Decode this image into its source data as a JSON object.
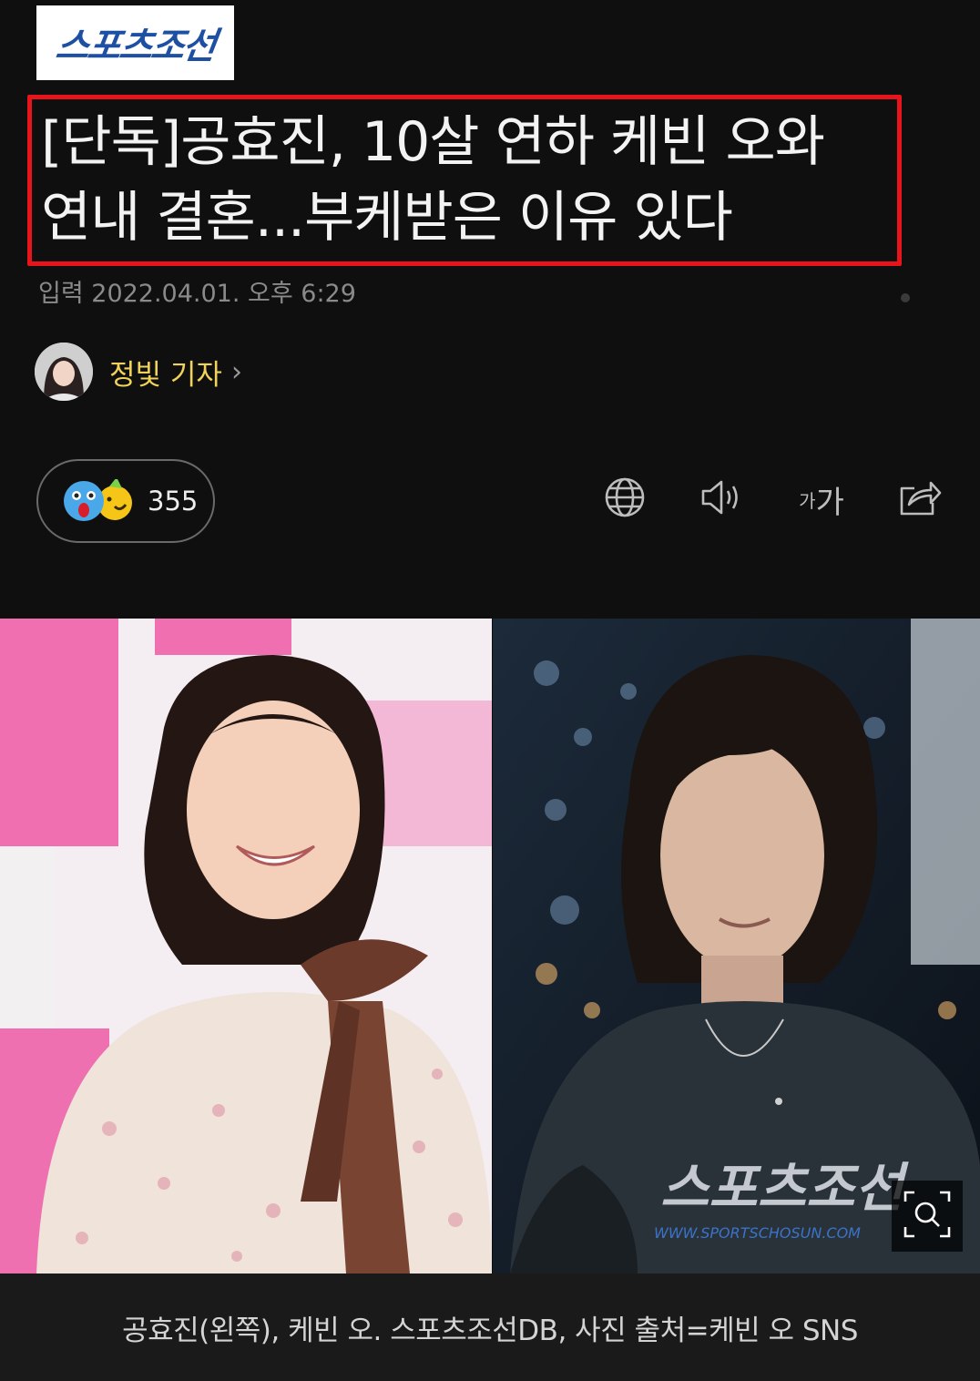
{
  "logo": {
    "text": "스포츠조선"
  },
  "article": {
    "headline_line1": "[단독]공효진, 10살 연하 케빈 오와",
    "headline_line2": "연내 결혼...부케받은 이유 있다",
    "published": "입력 2022.04.01. 오후 6:29",
    "author": "정빛 기자"
  },
  "reactions": {
    "count": "355",
    "icon": "surprised-and-party-emoji"
  },
  "toolbar": {
    "translate_icon": "globe-icon",
    "listen_icon": "speaker-icon",
    "font_size_small": "가",
    "font_size_large": "가",
    "share_icon": "share-icon"
  },
  "photo": {
    "watermark": "스포츠조선",
    "watermark_url": "WWW.SPORTSCHOSUN.COM",
    "caption": "공효진(왼쪽), 케빈 오. 스포츠조선DB, 사진 출처=케빈 오 SNS"
  },
  "colors": {
    "background": "#0f0f0f",
    "highlight_border": "#e8141b",
    "author_name": "#f0d35a",
    "logo_blue": "#1d4fa3"
  }
}
